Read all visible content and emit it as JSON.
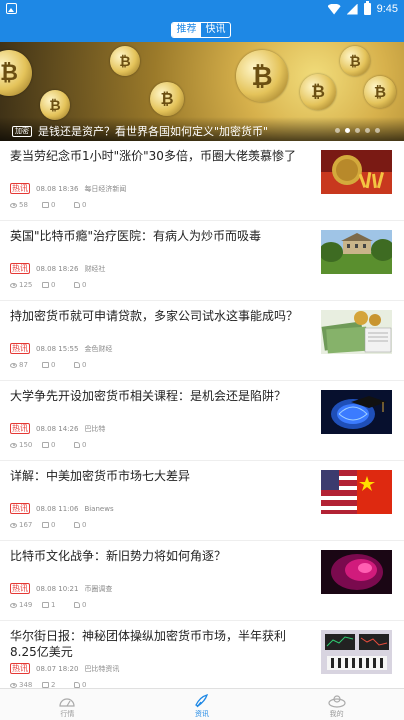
{
  "status_bar": {
    "time": "9:45",
    "left_icon": "photo-icon",
    "icons": [
      "wifi-icon",
      "signal-icon",
      "battery-icon"
    ]
  },
  "header": {
    "tabs": [
      {
        "label": "推荐",
        "active": true
      },
      {
        "label": "快讯",
        "active": false
      }
    ]
  },
  "banner": {
    "tag": "加密",
    "title": "是钱还是资产？看世界各国如何定义\"加密货币\"",
    "coin_symbol": "₿",
    "dots": 5,
    "active_dot": 1
  },
  "news": [
    {
      "title": "麦当劳纪念币1小时\"涨价\"30多倍，币圈大佬羡慕惨了",
      "badge": "热讯",
      "date": "08.08 18:36",
      "source": "每日经济新闻",
      "views": "58",
      "comments": "0",
      "likes": "0"
    },
    {
      "title": "英国\"比特币瘾\"治疗医院：有病人为炒币而吸毒",
      "badge": "热讯",
      "date": "08.08 18:26",
      "source": "财经社",
      "views": "125",
      "comments": "0",
      "likes": "0"
    },
    {
      "title": "持加密货币就可申请贷款，多家公司试水这事能成吗？",
      "badge": "热讯",
      "date": "08.08 15:55",
      "source": "金色财经",
      "views": "87",
      "comments": "0",
      "likes": "0"
    },
    {
      "title": "大学争先开设加密货币相关课程：是机会还是陷阱？",
      "badge": "热讯",
      "date": "08.08 14:26",
      "source": "巴比特",
      "views": "150",
      "comments": "0",
      "likes": "0"
    },
    {
      "title": "详解：中美加密货币市场七大差异",
      "badge": "热讯",
      "date": "08.08 11:06",
      "source": "Bianews",
      "views": "167",
      "comments": "0",
      "likes": "0"
    },
    {
      "title": "比特币文化战争：新旧势力将如何角逐？",
      "badge": "热讯",
      "date": "08.08 10:21",
      "source": "币圈调查",
      "views": "149",
      "comments": "1",
      "likes": "0"
    },
    {
      "title": "华尔街日报：神秘团体操纵加密货币市场，半年获利8.25亿美元",
      "badge": "热讯",
      "date": "08.07 18:20",
      "source": "巴比特资讯",
      "views": "348",
      "comments": "2",
      "likes": "0"
    }
  ],
  "tabbar": [
    {
      "label": "行情",
      "icon": "market-icon",
      "active": false
    },
    {
      "label": "资讯",
      "icon": "news-icon",
      "active": true
    },
    {
      "label": "我的",
      "icon": "profile-icon",
      "active": false
    }
  ],
  "colors": {
    "primary": "#1e88e5",
    "badge": "#e53935"
  }
}
